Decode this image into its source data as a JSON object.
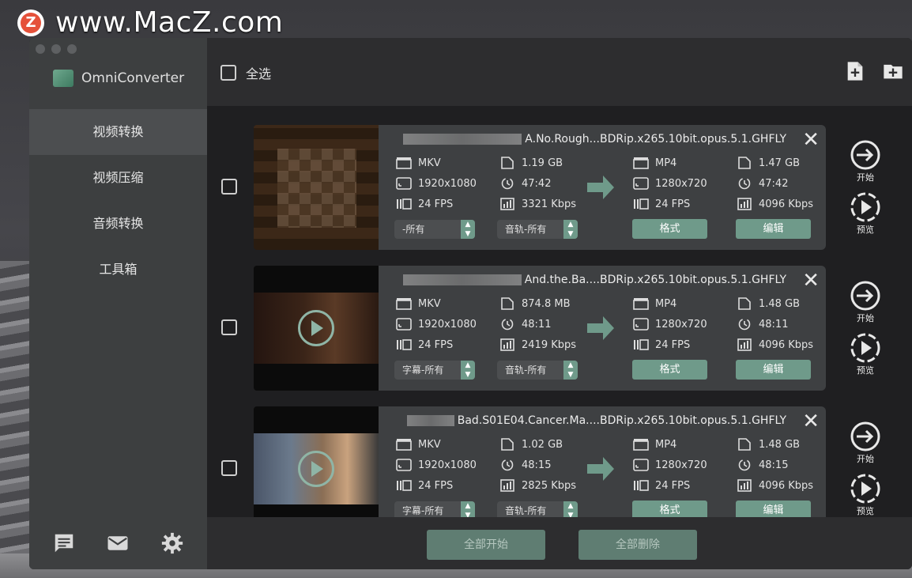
{
  "watermark": {
    "logo_letter": "Z",
    "text": "www.MacZ.com"
  },
  "app": {
    "name": "OmniConverter"
  },
  "sidebar": {
    "items": [
      {
        "label": "视频转换",
        "active": true
      },
      {
        "label": "视频压缩",
        "active": false
      },
      {
        "label": "音频转换",
        "active": false
      },
      {
        "label": "工具箱",
        "active": false
      }
    ],
    "footer_icons": [
      "chat-icon",
      "mail-icon",
      "gear-icon"
    ]
  },
  "topbar": {
    "select_all_label": "全选",
    "icons": [
      "add-file-icon",
      "add-folder-icon"
    ]
  },
  "files": [
    {
      "filename": "A.No.Rough...BDRip.x265.10bit.opus.5.1.GHFLY",
      "src": {
        "format": "MKV",
        "size": "1.19 GB",
        "resolution": "1920x1080",
        "duration": "47:42",
        "fps": "24 FPS",
        "bitrate": "3321 Kbps"
      },
      "dst": {
        "format": "MP4",
        "size": "1.47 GB",
        "resolution": "1280x720",
        "duration": "47:42",
        "fps": "24 FPS",
        "bitrate": "4096 Kbps"
      },
      "subtitle_select": "-所有",
      "audio_select": "音轨-所有",
      "format_btn": "格式",
      "edit_btn": "编辑",
      "start_label": "开始",
      "preview_label": "预览",
      "thumb_style": "pixelated",
      "show_play": false
    },
    {
      "filename": "And.the.Ba....BDRip.x265.10bit.opus.5.1.GHFLY",
      "src": {
        "format": "MKV",
        "size": "874.8 MB",
        "resolution": "1920x1080",
        "duration": "48:11",
        "fps": "24 FPS",
        "bitrate": "2419 Kbps"
      },
      "dst": {
        "format": "MP4",
        "size": "1.48 GB",
        "resolution": "1280x720",
        "duration": "48:11",
        "fps": "24 FPS",
        "bitrate": "4096 Kbps"
      },
      "subtitle_select": "字幕-所有",
      "audio_select": "音轨-所有",
      "format_btn": "格式",
      "edit_btn": "编辑",
      "start_label": "开始",
      "preview_label": "预览",
      "thumb_style": "dark",
      "show_play": true
    },
    {
      "filename": "Bad.S01E04.Cancer.Ma....BDRip.x265.10bit.opus.5.1.GHFLY",
      "src": {
        "format": "MKV",
        "size": "1.02 GB",
        "resolution": "1920x1080",
        "duration": "48:15",
        "fps": "24 FPS",
        "bitrate": "2825 Kbps"
      },
      "dst": {
        "format": "MP4",
        "size": "1.48 GB",
        "resolution": "1280x720",
        "duration": "48:15",
        "fps": "24 FPS",
        "bitrate": "4096 Kbps"
      },
      "subtitle_select": "字幕-所有",
      "audio_select": "音轨-所有",
      "format_btn": "格式",
      "edit_btn": "编辑",
      "start_label": "开始",
      "preview_label": "预览",
      "thumb_style": "scene",
      "show_play": true
    }
  ],
  "bottombar": {
    "start_all": "全部开始",
    "delete_all": "全部删除"
  },
  "colors": {
    "accent": "#6f9a8a",
    "card": "#3e4042",
    "sidebar": "#3d3f40"
  }
}
